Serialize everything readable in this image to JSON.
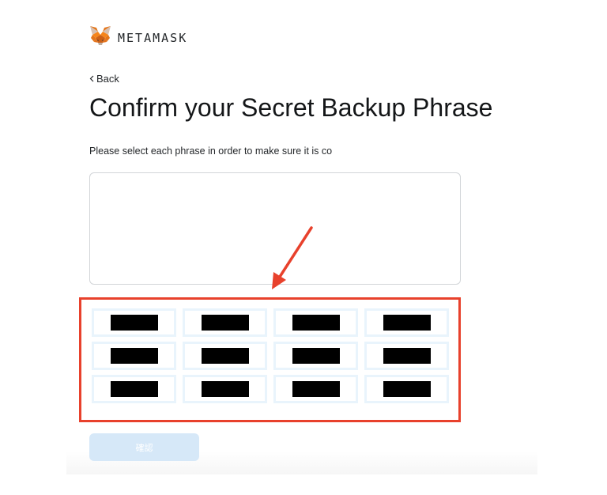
{
  "brand": {
    "name": "METAMASK",
    "logo_icon": "metamask-fox-icon"
  },
  "nav": {
    "back_label": "Back",
    "back_icon": "chevron-left-icon"
  },
  "header": {
    "title": "Confirm your Secret Backup Phrase"
  },
  "instructions": {
    "text": "Please select each phrase in order to make sure it is co"
  },
  "word_bank": {
    "note": "all 12 seed words are covered by black redaction boxes",
    "words": [
      "",
      "",
      "",
      "",
      "",
      "",
      "",
      "",
      "",
      "",
      "",
      ""
    ]
  },
  "annotation": {
    "arrow_icon": "red-arrow-icon",
    "highlight_color": "#e8412c"
  },
  "footer": {
    "confirm_label": "確認"
  },
  "colors": {
    "accent": "#e8412c",
    "chip_border": "#e9f4fc",
    "button_disabled": "#d6e8f8",
    "text": "#24272a"
  }
}
